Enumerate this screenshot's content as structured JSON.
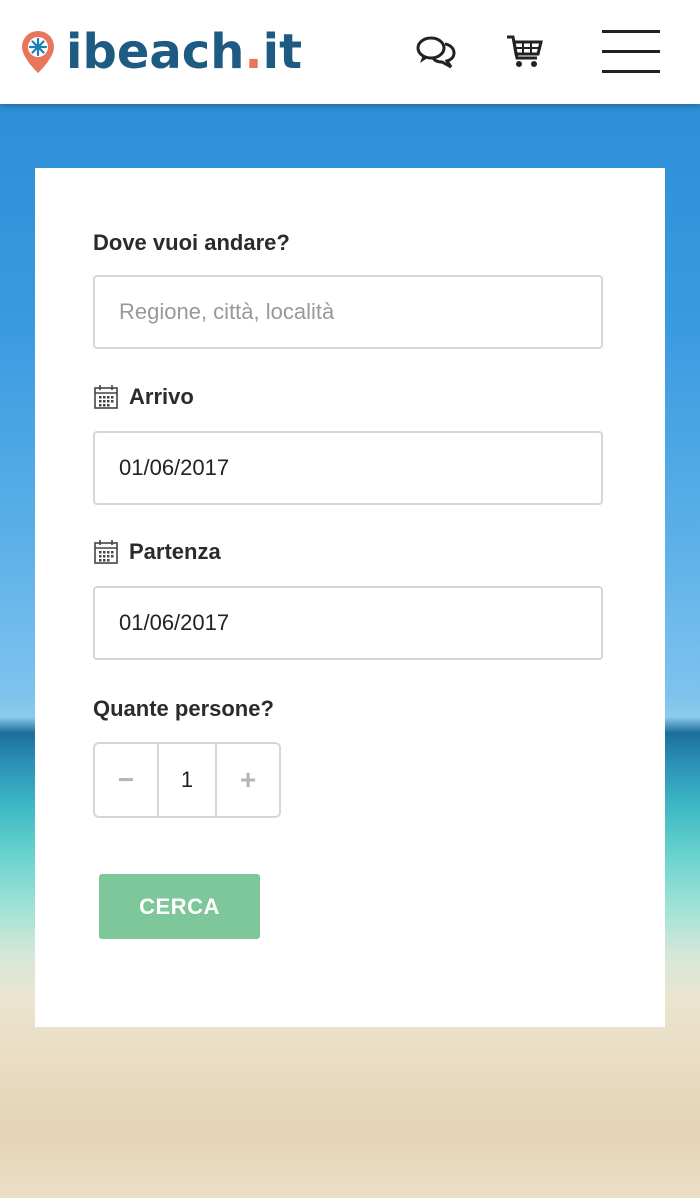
{
  "header": {
    "logo_text": "ibeach",
    "logo_dot": ".",
    "logo_tld": "it",
    "chat_icon": "chat-bubbles-icon",
    "cart_icon": "cart-icon",
    "menu_icon": "hamburger-menu-icon"
  },
  "form": {
    "destination": {
      "label": "Dove vuoi andare?",
      "placeholder": "Regione, città, località",
      "value": ""
    },
    "arrival": {
      "label": "Arrivo",
      "value": "01/06/2017"
    },
    "departure": {
      "label": "Partenza",
      "value": "01/06/2017"
    },
    "people": {
      "label": "Quante persone?",
      "decrement": "−",
      "value": "1",
      "increment": "+"
    },
    "search_label": "CERCA"
  },
  "colors": {
    "brand_blue": "#1e5b83",
    "brand_orange": "#e8765a",
    "search_green": "#7dc79b"
  }
}
